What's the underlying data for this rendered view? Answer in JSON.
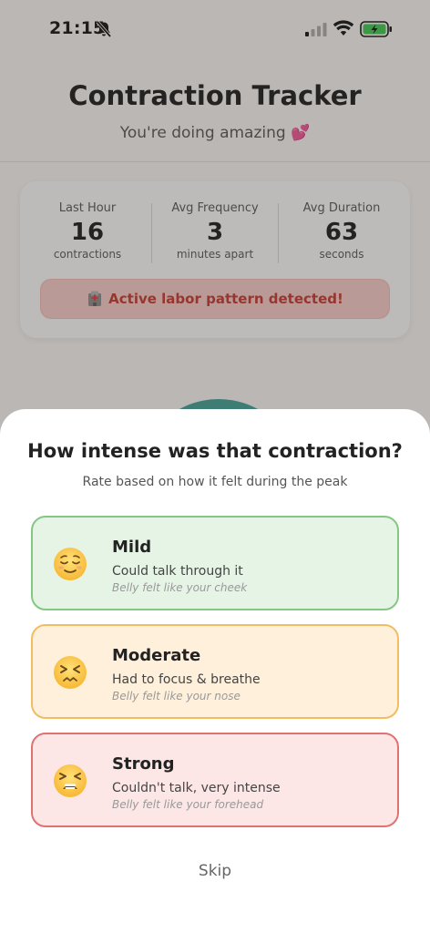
{
  "status_bar": {
    "time": "21:15"
  },
  "header": {
    "title": "Contraction Tracker",
    "subtitle": "You're doing amazing 💕"
  },
  "stats": [
    {
      "label": "Last Hour",
      "value": "16",
      "unit": "contractions"
    },
    {
      "label": "Avg Frequency",
      "value": "3",
      "unit": "minutes apart"
    },
    {
      "label": "Avg Duration",
      "value": "63",
      "unit": "seconds"
    }
  ],
  "alert": {
    "text": "Active labor pattern detected!",
    "icon": "hospital-icon"
  },
  "sheet": {
    "title": "How intense was that contraction?",
    "subtitle": "Rate based on how it felt during the peak",
    "options": [
      {
        "title": "Mild",
        "description": "Could talk through it",
        "hint": "Belly felt like your cheek",
        "icon": "relieved-face-icon",
        "color": "#84c784"
      },
      {
        "title": "Moderate",
        "description": "Had to focus & breathe",
        "hint": "Belly felt like your nose",
        "icon": "confounded-face-icon",
        "color": "#f2bd62"
      },
      {
        "title": "Strong",
        "description": "Couldn't talk, very intense",
        "hint": "Belly felt like your forehead",
        "icon": "tired-face-icon",
        "color": "#e07272"
      }
    ],
    "skip_label": "Skip"
  },
  "colors": {
    "accent_teal": "#3f9e92",
    "alert_red": "#c2352b"
  }
}
